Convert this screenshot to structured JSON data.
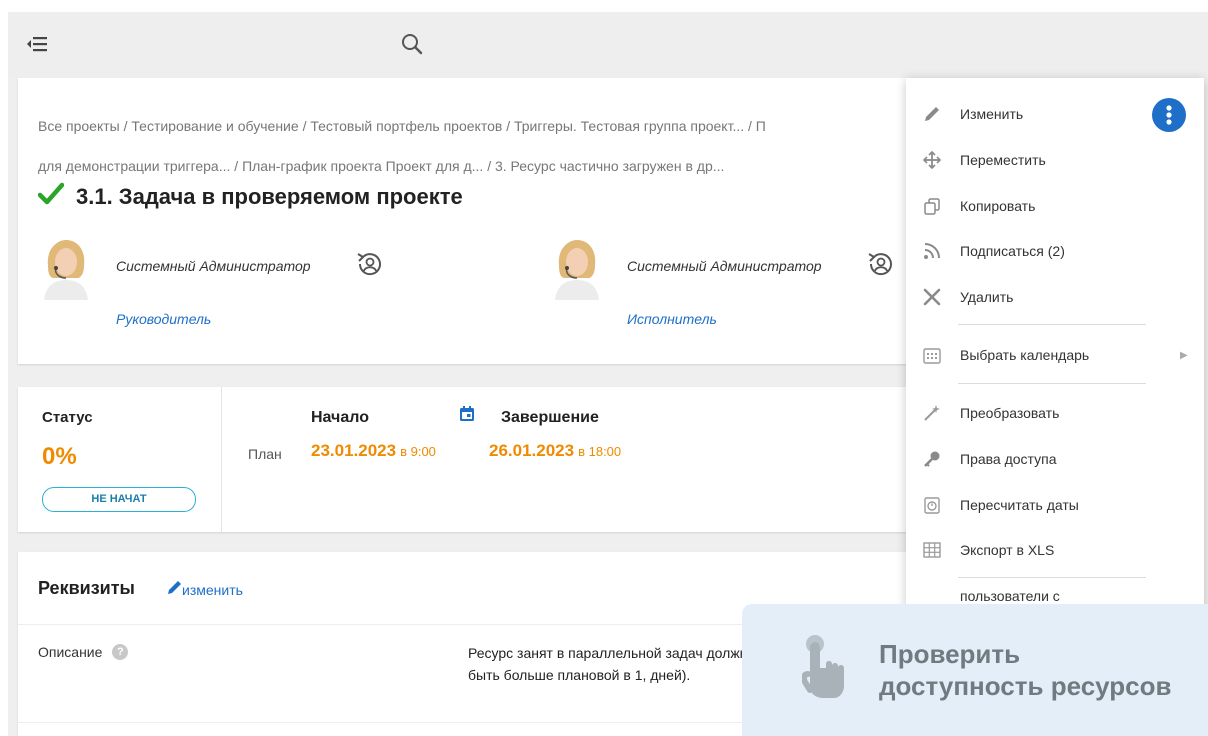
{
  "breadcrumb": {
    "line1": [
      "Все проекты",
      "Тестирование и обучение",
      "Тестовый портфель проектов",
      "Триггеры. Тестовая группа проект...",
      "П"
    ],
    "line2": [
      "для демонстрации триггера...",
      "План-график проекта Проект для д...",
      "3. Ресурс частично загружен в др..."
    ],
    "separator": " / "
  },
  "task": {
    "title": "3.1. Задача в проверяемом проекте",
    "status_check_color": "#2aa52a"
  },
  "people": [
    {
      "name": "Системный Администратор",
      "role": "Руководитель"
    },
    {
      "name": "Системный Администратор",
      "role": "Исполнитель"
    }
  ],
  "status": {
    "label": "Статус",
    "value": "0%",
    "badge": "НЕ НАЧАТ"
  },
  "schedule": {
    "start_label": "Начало",
    "end_label": "Завершение",
    "plan_label": "План",
    "start_date": "23.01.2023",
    "start_time": "в 9:00",
    "end_date": "26.01.2023",
    "end_time": "в 18:00"
  },
  "props": {
    "title": "Реквизиты",
    "edit_label": "изменить",
    "description_label": "Описание",
    "help_glyph": "?",
    "description_text": "Ресурс занят в параллельной задач должна быть больше плановой в 1, дней)."
  },
  "menu": {
    "items": [
      {
        "label": "Изменить",
        "icon": "pencil-icon"
      },
      {
        "label": "Переместить",
        "icon": "move-icon"
      },
      {
        "label": "Копировать",
        "icon": "copy-icon"
      },
      {
        "label": "Подписаться (2)",
        "icon": "rss-icon"
      },
      {
        "label": "Удалить",
        "icon": "close-icon"
      },
      {
        "label": "Выбрать календарь",
        "icon": "calendar-icon"
      },
      {
        "label": "Преобразовать",
        "icon": "magic-wand-icon"
      },
      {
        "label": "Права доступа",
        "icon": "key-icon"
      },
      {
        "label": "Пересчитать даты",
        "icon": "timer-icon"
      },
      {
        "label": "Экспорт в XLS",
        "icon": "table-icon"
      },
      {
        "label": "пользователи с",
        "icon": "user-icon"
      }
    ]
  },
  "callout": {
    "line1": "Проверить",
    "line2": "доступность ресурсов"
  },
  "colors": {
    "accent_blue": "#1e6fc8",
    "orange": "#f08a00",
    "badge_border": "#2bb0d8",
    "callout_bg": "#e3eef9"
  }
}
